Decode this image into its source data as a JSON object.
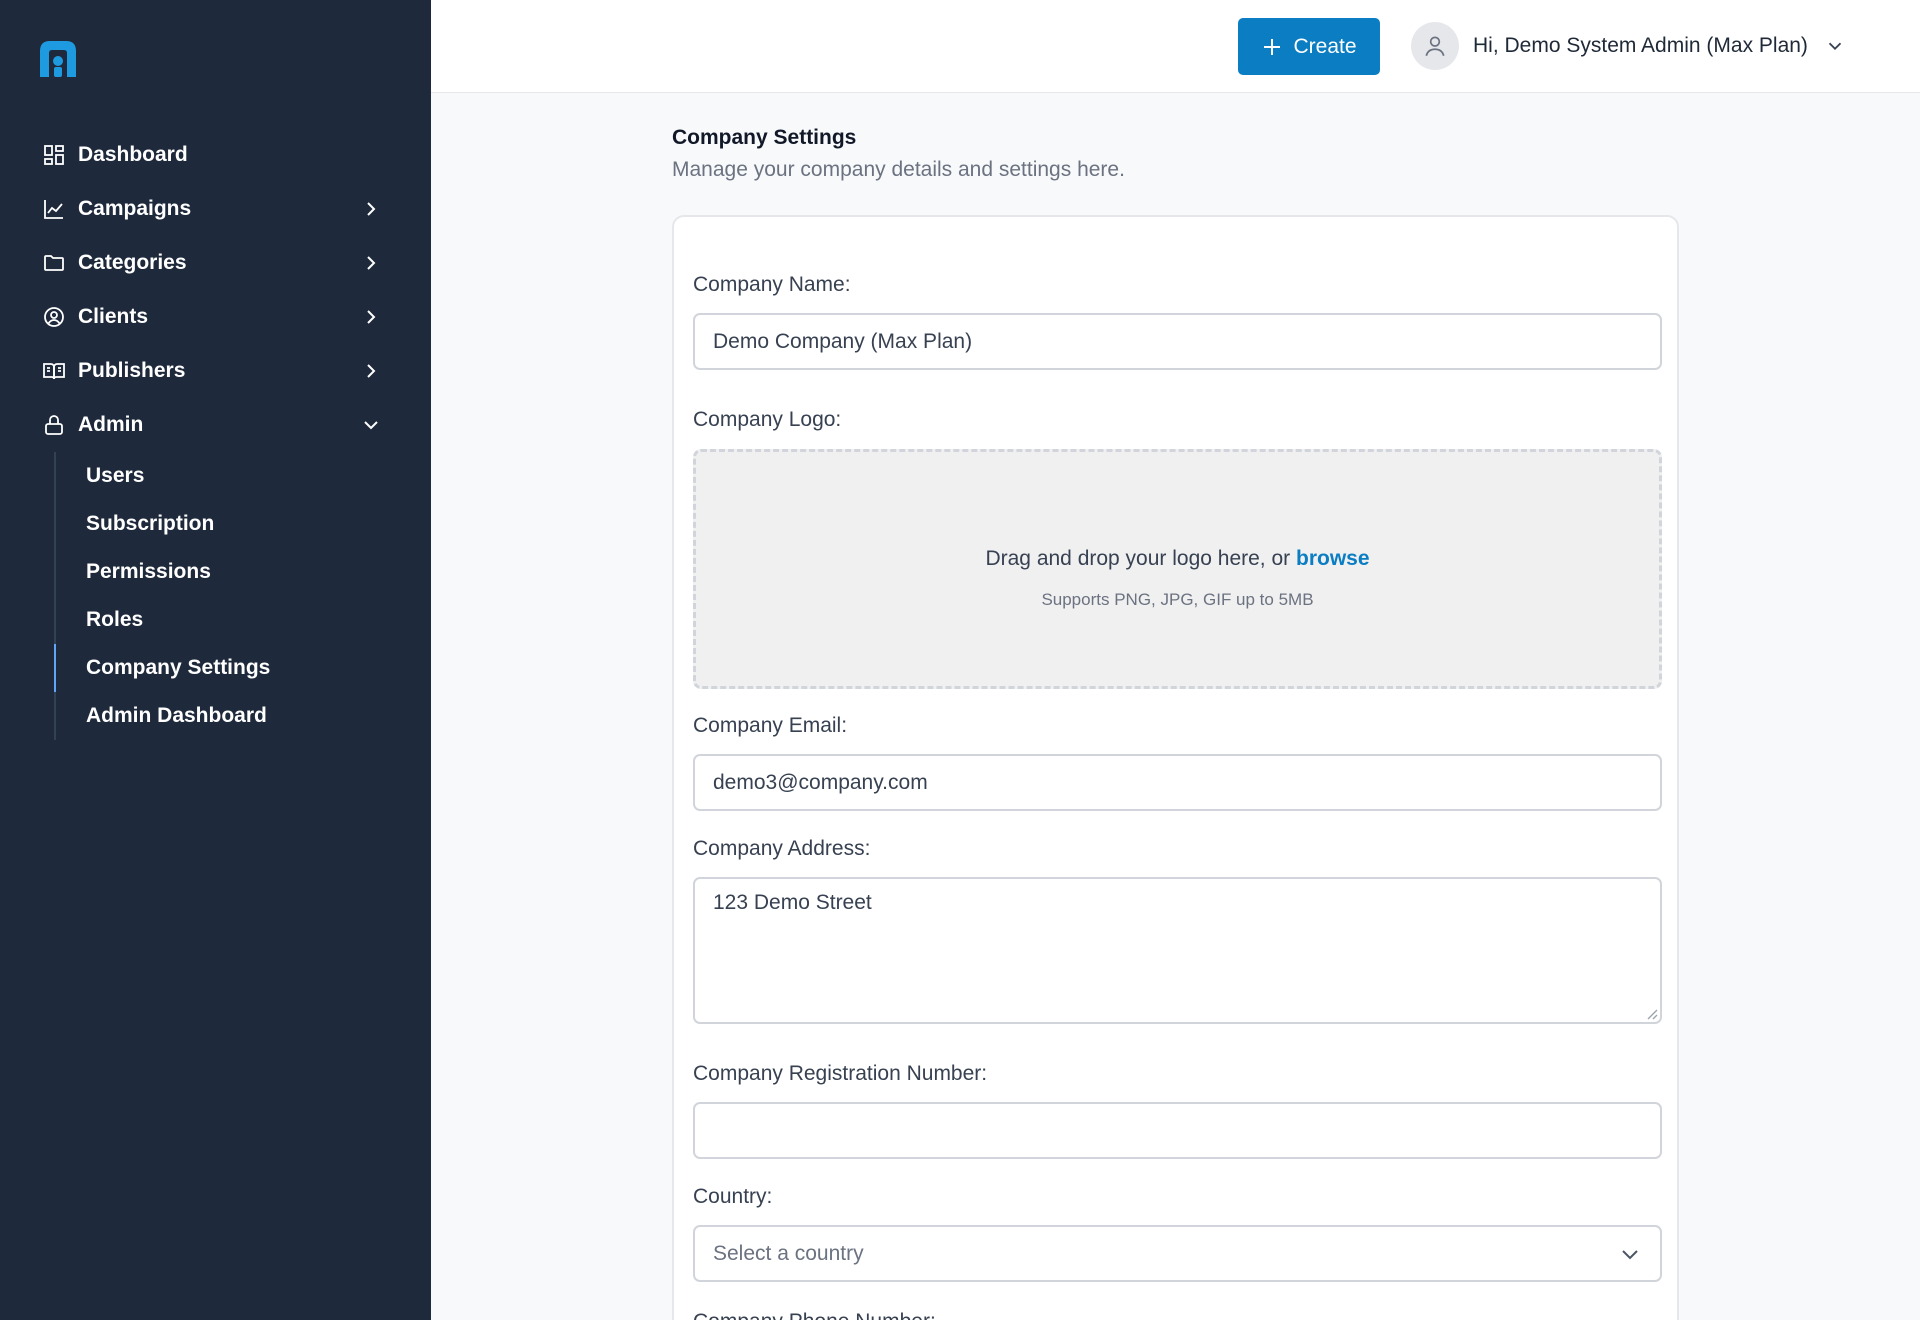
{
  "sidebar": {
    "items": [
      {
        "label": "Dashboard",
        "icon": "dashboard-icon"
      },
      {
        "label": "Campaigns",
        "icon": "chart-icon"
      },
      {
        "label": "Categories",
        "icon": "folder-icon"
      },
      {
        "label": "Clients",
        "icon": "user-circle-icon"
      },
      {
        "label": "Publishers",
        "icon": "book-icon"
      },
      {
        "label": "Admin",
        "icon": "lock-icon"
      }
    ],
    "admin_subitems": [
      "Users",
      "Subscription",
      "Permissions",
      "Roles",
      "Company Settings",
      "Admin Dashboard"
    ],
    "active_subitem": "Company Settings"
  },
  "header": {
    "create_label": "Create",
    "user_greeting": "Hi, Demo System Admin (Max Plan)"
  },
  "page": {
    "title": "Company Settings",
    "subtitle": "Manage your company details and settings here."
  },
  "form": {
    "company_name_label": "Company Name:",
    "company_name_value": "Demo Company (Max Plan)",
    "company_logo_label": "Company Logo:",
    "dropzone_text": "Drag and drop your logo here, or",
    "dropzone_link": "browse",
    "dropzone_hint": "Supports PNG, JPG, GIF up to 5MB",
    "company_email_label": "Company Email:",
    "company_email_value": "demo3@company.com",
    "company_address_label": "Company Address:",
    "company_address_value": "123 Demo Street",
    "registration_label": "Company Registration Number:",
    "registration_value": "",
    "country_label": "Country:",
    "country_placeholder": "Select a country",
    "phone_label": "Company Phone Number:"
  },
  "colors": {
    "sidebar_bg": "#1e293b",
    "accent": "#0b7dc3"
  }
}
